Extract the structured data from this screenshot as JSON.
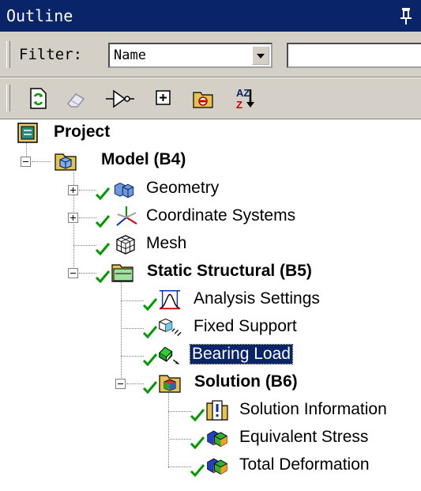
{
  "panel": {
    "title": "Outline"
  },
  "filter": {
    "label": "Filter:",
    "selected": "Name",
    "search_value": ""
  },
  "toolbar": {
    "buttons": [
      "refresh-icon",
      "eraser-icon",
      "connection-icon",
      "expand-all-icon",
      "folder-icon",
      "sort-az-icon"
    ],
    "sort_icon_letters": "AZ"
  },
  "tree": {
    "project": "Project",
    "model": "Model (B4)",
    "geometry": "Geometry",
    "coordinate_systems": "Coordinate Systems",
    "mesh": "Mesh",
    "static_structural": "Static Structural (B5)",
    "analysis_settings": "Analysis Settings",
    "fixed_support": "Fixed Support",
    "bearing_load": "Bearing Load",
    "solution": "Solution (B6)",
    "solution_information": "Solution Information",
    "equivalent_stress": "Equivalent Stress",
    "total_deformation": "Total Deformation"
  },
  "colors": {
    "title_bg": "#0a246a",
    "check_green": "#009a00",
    "selected_bg": "#0a246a"
  }
}
